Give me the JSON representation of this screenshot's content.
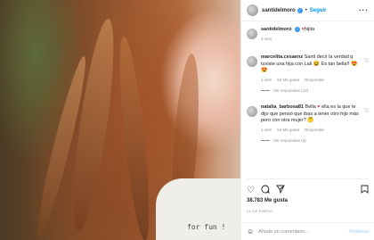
{
  "post": {
    "username": "santidelmoro",
    "follow_label": "Seguir",
    "caption_username": "santidelmoro",
    "caption_text": "hijita",
    "caption_time": "1 sem",
    "likes": "38.783 Me gusta",
    "date": "24 DE ENERO",
    "shirt_text": "for fun !"
  },
  "comments": [
    {
      "username": "marcelita.cesaenz",
      "text": "Santi decir la verdad q tuviste una hija con Lali",
      "text2": "Es tan bella!!",
      "time": "1 sem",
      "likes": "62 Me gusta",
      "reply": "Responder",
      "view_replies": "Ver respuestas (12)"
    },
    {
      "username": "natalia_barbosa81",
      "text": "Bella",
      "text2": "ella es la que te dijo que pensó que ibas a tener otro hijo más pero con otra mujer?",
      "time": "1 sem",
      "likes": "54 Me gusta",
      "reply": "Responder",
      "view_replies": "Ver respuestas (2)"
    }
  ],
  "add_comment": {
    "placeholder": "Añade un comentario...",
    "publish_label": "Publicar"
  },
  "icons": {
    "more": "more-options-icon",
    "heart": "heart-icon",
    "comment": "comment-icon",
    "share": "share-icon",
    "save": "bookmark-icon",
    "emoji": "emoji-icon"
  }
}
